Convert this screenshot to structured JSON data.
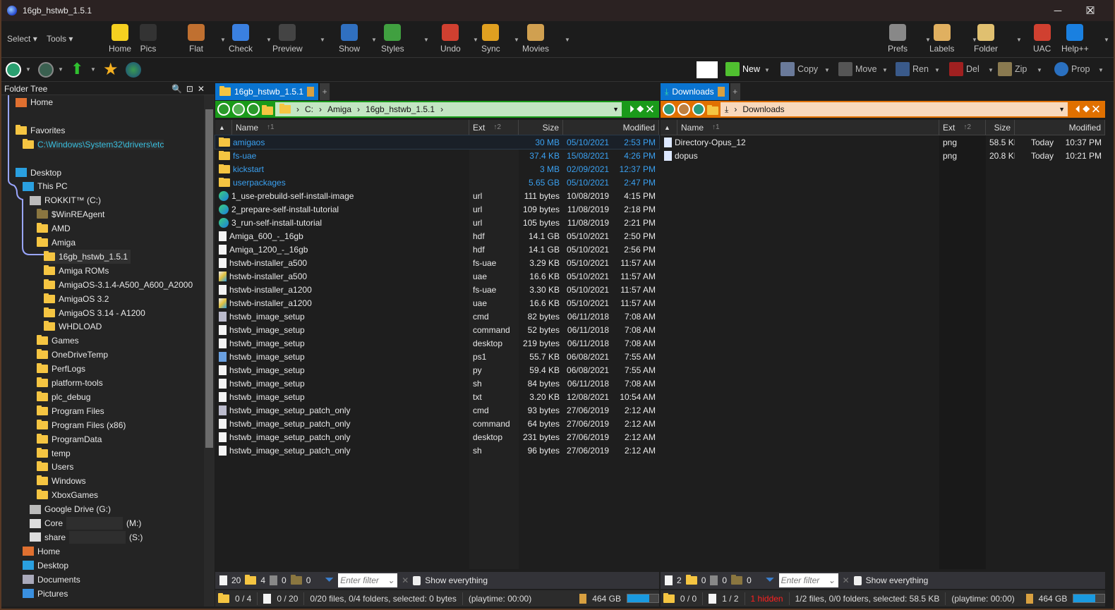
{
  "window": {
    "title": "16gb_hstwb_1.5.1"
  },
  "toolbar1": {
    "menus": [
      "Select",
      "Tools"
    ],
    "buttons": [
      {
        "label": "Home",
        "icon": "smiley-icon",
        "color": "#f5d020"
      },
      {
        "label": "Pics",
        "icon": "camera-icon",
        "color": "#333333"
      },
      {
        "label": "Flat",
        "icon": "hammer-icon",
        "color": "#c07030"
      },
      {
        "label": "Check",
        "icon": "checkbox-icon",
        "color": "#3a80e0"
      },
      {
        "label": "Preview",
        "icon": "eye-icon",
        "color": "#444444"
      },
      {
        "label": "Show",
        "icon": "window-icon",
        "color": "#3070c0"
      },
      {
        "label": "Styles",
        "icon": "styles-icon",
        "color": "#40a040"
      },
      {
        "label": "Undo",
        "icon": "undo-icon",
        "color": "#d04030"
      },
      {
        "label": "Sync",
        "icon": "sync-icon",
        "color": "#e0a020"
      },
      {
        "label": "Movies",
        "icon": "movies-icon",
        "color": "#d0a050"
      },
      {
        "label": "Prefs",
        "icon": "gear-icon",
        "color": "#888888"
      },
      {
        "label": "Labels",
        "icon": "label-icon",
        "color": "#e0b060"
      },
      {
        "label": "Folder",
        "icon": "folder-options-icon",
        "color": "#e0c070"
      },
      {
        "label": "UAC",
        "icon": "shield-icon",
        "color": "#d04030"
      },
      {
        "label": "Help++",
        "icon": "help-icon",
        "color": "#1a80e0"
      }
    ]
  },
  "toolbar2": {
    "buttons": [
      {
        "label": "New",
        "icon": "plus-icon",
        "color": "#50c030"
      },
      {
        "label": "Copy",
        "icon": "copy-icon",
        "color": "#6a7a9a"
      },
      {
        "label": "Move",
        "icon": "move-icon",
        "color": "#555555"
      },
      {
        "label": "Ren",
        "icon": "rename-icon",
        "color": "#3a5a8a"
      },
      {
        "label": "Del",
        "icon": "delete-icon",
        "color": "#a02020"
      },
      {
        "label": "Zip",
        "icon": "zip-icon",
        "color": "#8a7a50"
      },
      {
        "label": "Prop",
        "icon": "info-icon",
        "color": "#2a70c0"
      }
    ]
  },
  "tree": {
    "title": "Folder Tree",
    "items": [
      {
        "label": "Home",
        "level": 0,
        "icon": "home"
      },
      {
        "label": "",
        "level": 0,
        "icon": "none"
      },
      {
        "label": "Favorites",
        "level": 0,
        "icon": "folder"
      },
      {
        "label": "C:\\Windows\\System32\\drivers\\etc",
        "level": 1,
        "icon": "folder",
        "link": true
      },
      {
        "label": "",
        "level": 0,
        "icon": "none"
      },
      {
        "label": "Desktop",
        "level": 0,
        "icon": "desktop"
      },
      {
        "label": "This PC",
        "level": 1,
        "icon": "pc"
      },
      {
        "label": "ROKKIT™ (C:)",
        "level": 2,
        "icon": "drive"
      },
      {
        "label": "$WinREAgent",
        "level": 3,
        "icon": "folder-dim"
      },
      {
        "label": "AMD",
        "level": 3,
        "icon": "folder"
      },
      {
        "label": "Amiga",
        "level": 3,
        "icon": "folder"
      },
      {
        "label": "16gb_hstwb_1.5.1",
        "level": 4,
        "icon": "folder",
        "selected": true
      },
      {
        "label": "Amiga ROMs",
        "level": 4,
        "icon": "folder"
      },
      {
        "label": "AmigaOS-3.1.4-A500_A600_A2000",
        "level": 4,
        "icon": "folder"
      },
      {
        "label": "AmigaOS 3.2",
        "level": 4,
        "icon": "folder"
      },
      {
        "label": "AmigaOS 3.14 - A1200",
        "level": 4,
        "icon": "folder"
      },
      {
        "label": "WHDLOAD",
        "level": 4,
        "icon": "folder"
      },
      {
        "label": "Games",
        "level": 3,
        "icon": "folder"
      },
      {
        "label": "OneDriveTemp",
        "level": 3,
        "icon": "folder"
      },
      {
        "label": "PerfLogs",
        "level": 3,
        "icon": "folder"
      },
      {
        "label": "platform-tools",
        "level": 3,
        "icon": "folder"
      },
      {
        "label": "plc_debug",
        "level": 3,
        "icon": "folder"
      },
      {
        "label": "Program Files",
        "level": 3,
        "icon": "folder"
      },
      {
        "label": "Program Files (x86)",
        "level": 3,
        "icon": "folder"
      },
      {
        "label": "ProgramData",
        "level": 3,
        "icon": "folder"
      },
      {
        "label": "temp",
        "level": 3,
        "icon": "folder"
      },
      {
        "label": "Users",
        "level": 3,
        "icon": "folder"
      },
      {
        "label": "Windows",
        "level": 3,
        "icon": "folder"
      },
      {
        "label": "XboxGames",
        "level": 3,
        "icon": "folder"
      },
      {
        "label": "Google Drive (G:)",
        "level": 2,
        "icon": "drive"
      },
      {
        "label": "Core",
        "level": 2,
        "icon": "netdrive",
        "suffix": "(M:)"
      },
      {
        "label": "share",
        "level": 2,
        "icon": "netdrive",
        "suffix": "(S:)"
      },
      {
        "label": "Home",
        "level": 1,
        "icon": "home"
      },
      {
        "label": "Desktop",
        "level": 1,
        "icon": "desktop"
      },
      {
        "label": "Documents",
        "level": 1,
        "icon": "docs"
      },
      {
        "label": "Pictures",
        "level": 1,
        "icon": "pics"
      }
    ]
  },
  "left": {
    "tab": "16gb_hstwb_1.5.1",
    "path": [
      "C:",
      "Amiga",
      "16gb_hstwb_1.5.1"
    ],
    "columns": {
      "name": "Name",
      "name_sort": "↑1",
      "ext": "Ext",
      "ext_sort": "↑2",
      "size": "Size",
      "modified": "Modified"
    },
    "files": [
      {
        "name": "amigaos",
        "ext": "",
        "size": "30 MB",
        "date": "05/10/2021",
        "time": "2:53 PM",
        "type": "dir"
      },
      {
        "name": "fs-uae",
        "ext": "",
        "size": "37.4 KB",
        "date": "15/08/2021",
        "time": "4:26 PM",
        "type": "dir"
      },
      {
        "name": "kickstart",
        "ext": "",
        "size": "3 MB",
        "date": "02/09/2021",
        "time": "12:37 PM",
        "type": "dir"
      },
      {
        "name": "userpackages",
        "ext": "",
        "size": "5.65 GB",
        "date": "05/10/2021",
        "time": "2:47 PM",
        "type": "dir"
      },
      {
        "name": "1_use-prebuild-self-install-image",
        "ext": "url",
        "size": "111 bytes",
        "date": "10/08/2019",
        "time": "4:15 PM",
        "type": "url"
      },
      {
        "name": "2_prepare-self-install-tutorial",
        "ext": "url",
        "size": "109 bytes",
        "date": "11/08/2019",
        "time": "2:18 PM",
        "type": "url"
      },
      {
        "name": "3_run-self-install-tutorial",
        "ext": "url",
        "size": "105 bytes",
        "date": "11/08/2019",
        "time": "2:21 PM",
        "type": "url"
      },
      {
        "name": "Amiga_600_-_16gb",
        "ext": "hdf",
        "size": "14.1 GB",
        "date": "05/10/2021",
        "time": "2:50 PM",
        "type": "file"
      },
      {
        "name": "Amiga_1200_-_16gb",
        "ext": "hdf",
        "size": "14.1 GB",
        "date": "05/10/2021",
        "time": "2:56 PM",
        "type": "file"
      },
      {
        "name": "hstwb-installer_a500",
        "ext": "fs-uae",
        "size": "3.29 KB",
        "date": "05/10/2021",
        "time": "11:57 AM",
        "type": "file"
      },
      {
        "name": "hstwb-installer_a500",
        "ext": "uae",
        "size": "16.6 KB",
        "date": "05/10/2021",
        "time": "11:57 AM",
        "type": "uae"
      },
      {
        "name": "hstwb-installer_a1200",
        "ext": "fs-uae",
        "size": "3.30 KB",
        "date": "05/10/2021",
        "time": "11:57 AM",
        "type": "file"
      },
      {
        "name": "hstwb-installer_a1200",
        "ext": "uae",
        "size": "16.6 KB",
        "date": "05/10/2021",
        "time": "11:57 AM",
        "type": "uae"
      },
      {
        "name": "hstwb_image_setup",
        "ext": "cmd",
        "size": "82 bytes",
        "date": "06/11/2018",
        "time": "7:08 AM",
        "type": "cmd"
      },
      {
        "name": "hstwb_image_setup",
        "ext": "command",
        "size": "52 bytes",
        "date": "06/11/2018",
        "time": "7:08 AM",
        "type": "file"
      },
      {
        "name": "hstwb_image_setup",
        "ext": "desktop",
        "size": "219 bytes",
        "date": "06/11/2018",
        "time": "7:08 AM",
        "type": "file"
      },
      {
        "name": "hstwb_image_setup",
        "ext": "ps1",
        "size": "55.7 KB",
        "date": "06/08/2021",
        "time": "7:55 AM",
        "type": "ps1"
      },
      {
        "name": "hstwb_image_setup",
        "ext": "py",
        "size": "59.4 KB",
        "date": "06/08/2021",
        "time": "7:55 AM",
        "type": "file"
      },
      {
        "name": "hstwb_image_setup",
        "ext": "sh",
        "size": "84 bytes",
        "date": "06/11/2018",
        "time": "7:08 AM",
        "type": "file"
      },
      {
        "name": "hstwb_image_setup",
        "ext": "txt",
        "size": "3.20 KB",
        "date": "12/08/2021",
        "time": "10:54 AM",
        "type": "file"
      },
      {
        "name": "hstwb_image_setup_patch_only",
        "ext": "cmd",
        "size": "93 bytes",
        "date": "27/06/2019",
        "time": "2:12 AM",
        "type": "cmd"
      },
      {
        "name": "hstwb_image_setup_patch_only",
        "ext": "command",
        "size": "64 bytes",
        "date": "27/06/2019",
        "time": "2:12 AM",
        "type": "file"
      },
      {
        "name": "hstwb_image_setup_patch_only",
        "ext": "desktop",
        "size": "231 bytes",
        "date": "27/06/2019",
        "time": "2:12 AM",
        "type": "file"
      },
      {
        "name": "hstwb_image_setup_patch_only",
        "ext": "sh",
        "size": "96 bytes",
        "date": "27/06/2019",
        "time": "2:12 AM",
        "type": "file"
      }
    ],
    "filter": {
      "files": "20",
      "folders": "4",
      "sel_files": "0",
      "sel_folders": "0",
      "placeholder": "Enter filter",
      "show_everything": "Show everything"
    },
    "status": {
      "folders": "0 / 4",
      "files": "0 / 20",
      "summary": "0/20 files, 0/4 folders, selected: 0 bytes",
      "playtime": "(playtime: 00:00)",
      "free": "464 GB",
      "used_fraction": 0.7
    }
  },
  "right": {
    "tab": "Downloads",
    "path": [
      "Downloads"
    ],
    "columns": {
      "name": "Name",
      "name_sort": "↑1",
      "ext": "Ext",
      "ext_sort": "↑2",
      "size": "Size",
      "modified": "Modified"
    },
    "files": [
      {
        "name": "Directory-Opus_12",
        "ext": "png",
        "size": "58.5 KB",
        "date": "Today",
        "time": "10:37 PM",
        "type": "png"
      },
      {
        "name": "dopus",
        "ext": "png",
        "size": "20.8 KB",
        "date": "Today",
        "time": "10:21 PM",
        "type": "png"
      }
    ],
    "filter": {
      "files": "2",
      "folders": "0",
      "sel_files": "0",
      "sel_folders": "0",
      "placeholder": "Enter filter",
      "show_everything": "Show everything"
    },
    "status": {
      "folders": "0 / 0",
      "files": "1 / 2",
      "hidden": "1 hidden",
      "summary": "1/2 files, 0/0 folders, selected: 58.5 KB",
      "playtime": "(playtime: 00:00)",
      "free": "464 GB",
      "used_fraction": 0.7
    }
  },
  "colors": {
    "left_path": "#1a9a1a",
    "left_path_field": "#c3e6c3",
    "right_path": "#e07000",
    "right_path_field": "#f8d8bc",
    "tab": "#0a74d0",
    "dir_text": "#3aa0f0",
    "hidden": "#ff2020"
  }
}
